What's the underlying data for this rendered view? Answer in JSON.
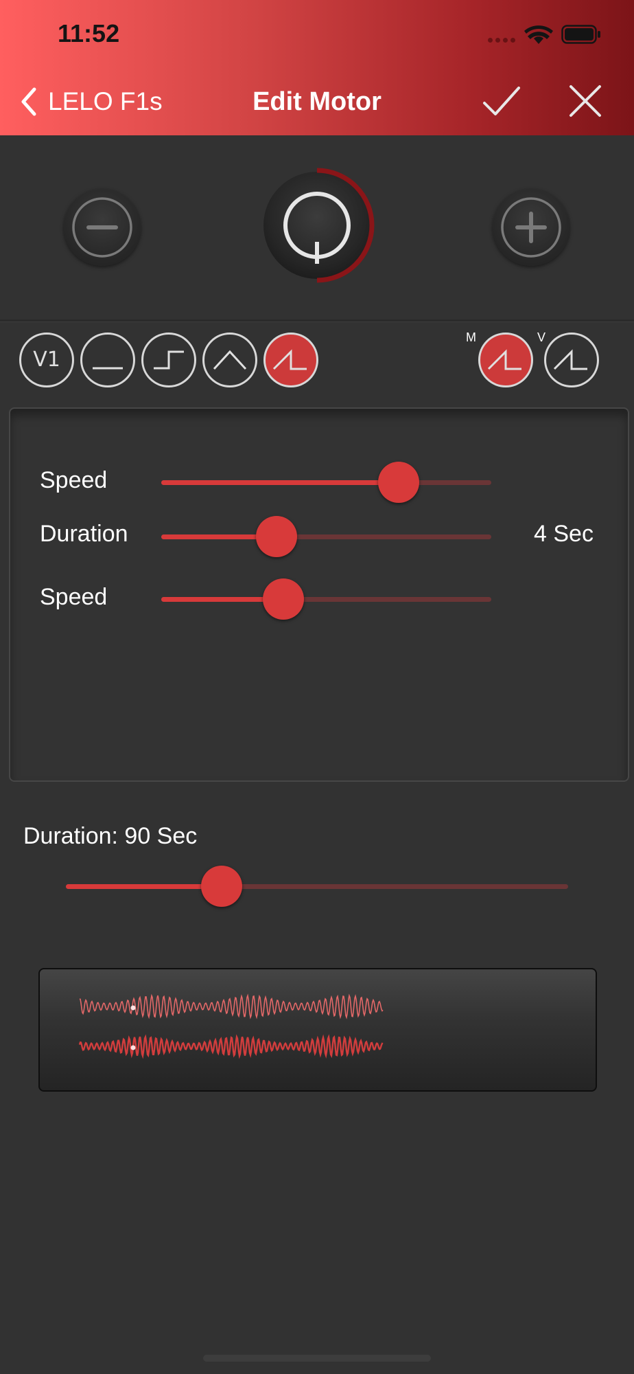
{
  "status_bar": {
    "time": "11:52"
  },
  "nav": {
    "back_label": "LELO F1s",
    "title": "Edit Motor"
  },
  "colors": {
    "accent": "#d83a3a",
    "background": "#323232",
    "header_start": "#ff5f5f",
    "header_end": "#7c1418"
  },
  "intensity": {
    "decrease_icon": "minus-icon",
    "power_icon": "power-icon",
    "increase_icon": "plus-icon",
    "level": 0.5
  },
  "patterns": {
    "v1_label": "V1",
    "items": [
      "v1",
      "constant",
      "step",
      "triangle",
      "sawtooth"
    ],
    "selected": "sawtooth",
    "motor_tags": {
      "m": "M",
      "v": "V"
    }
  },
  "panel": {
    "speed1": {
      "label": "Speed",
      "value": 0.72
    },
    "duration": {
      "label": "Duration",
      "value": 0.35,
      "display": "4 Sec"
    },
    "speed2": {
      "label": "Speed",
      "value": 0.37
    }
  },
  "overall": {
    "label": "Duration: 90 Sec",
    "value": 0.31
  }
}
